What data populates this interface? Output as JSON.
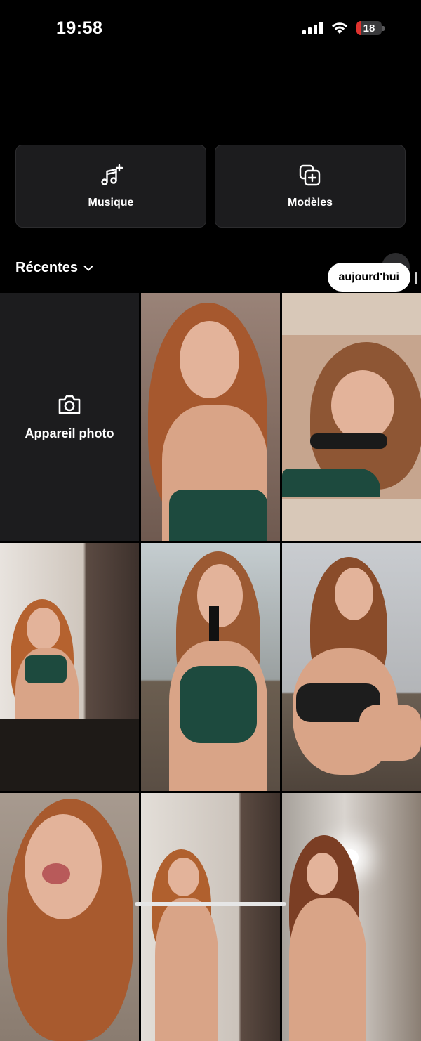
{
  "status_bar": {
    "time": "19:58",
    "battery_level": "18",
    "battery_color": "#e0322e",
    "wifi_icon": "wifi-icon",
    "signal_icon": "cellular-signal-icon"
  },
  "shortcuts": [
    {
      "label": "Musique",
      "icon": "music-note-add-icon"
    },
    {
      "label": "Modèles",
      "icon": "templates-add-icon"
    }
  ],
  "recents": {
    "title": "Récentes",
    "chevron_icon": "chevron-down-icon",
    "date_badge": "aujourd'hui"
  },
  "camera_tile": {
    "label": "Appareil photo",
    "icon": "camera-icon"
  },
  "media_thumbnails": [
    {
      "kind": "photo"
    },
    {
      "kind": "photo"
    },
    {
      "kind": "photo"
    },
    {
      "kind": "photo"
    },
    {
      "kind": "photo"
    },
    {
      "kind": "photo"
    },
    {
      "kind": "photo"
    },
    {
      "kind": "photo"
    }
  ]
}
